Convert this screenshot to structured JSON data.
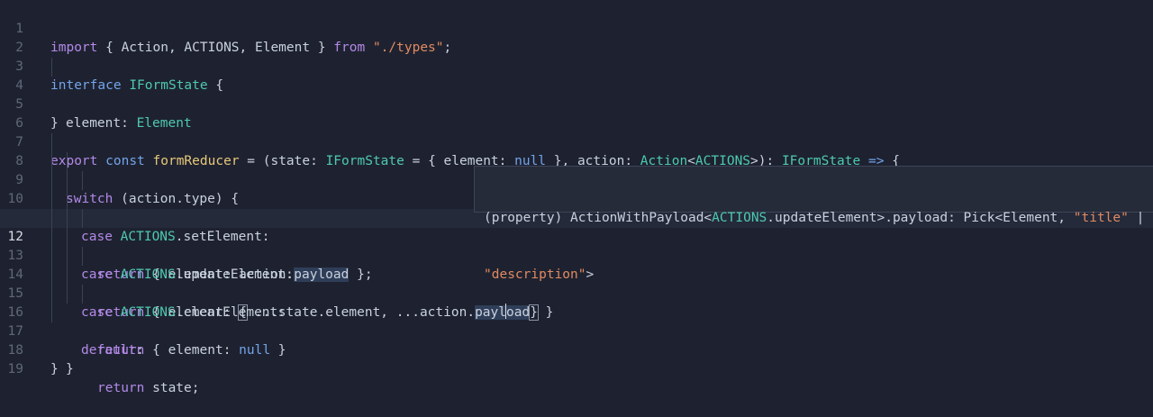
{
  "editor": {
    "line_numbers": [
      "1",
      "2",
      "3",
      "4",
      "5",
      "6",
      "7",
      "8",
      "9",
      "10",
      "11",
      "12",
      "13",
      "14",
      "15",
      "16",
      "17",
      "18",
      "19"
    ],
    "current_line": "12",
    "lines": {
      "l1": [
        "import",
        " { Action, ACTIONS, Element } ",
        "from",
        " ",
        "\"./types\"",
        ";"
      ],
      "l3": [
        "interface",
        " ",
        "IFormState",
        " {"
      ],
      "l4": [
        "element",
        ": ",
        "Element"
      ],
      "l5": [
        "}"
      ],
      "l7": [
        "export",
        " ",
        "const",
        " ",
        "formReducer",
        " = (state: ",
        "IFormState",
        " = { element: ",
        "null",
        " }, action: ",
        "Action",
        "<",
        "ACTIONS",
        ">): ",
        "IFormState",
        " ",
        "=>",
        " {"
      ],
      "l8": [
        "switch",
        " (action.type) {"
      ],
      "l9": [
        "case",
        " ",
        "ACTIONS",
        ".setElement:"
      ],
      "l10": [
        "return",
        " { element: action.",
        "payload",
        " };"
      ],
      "l11": [
        "case",
        " ",
        "ACTIONS",
        ".updateElement:"
      ],
      "l12": [
        "return",
        " { element: ",
        "{",
        " ...state.element, ...action.",
        "payl",
        "oad",
        "}",
        " }"
      ],
      "l13": [
        "case",
        " ",
        "ACTIONS",
        ".clearElement:"
      ],
      "l14": [
        "return",
        " { element: ",
        "null",
        " }"
      ],
      "l15": [
        "default",
        ":"
      ],
      "l16": [
        "return",
        " state;"
      ],
      "l17": [
        "}"
      ],
      "l18": [
        "}"
      ]
    }
  },
  "hover": {
    "line1": [
      "(property) ActionWithPayload<",
      "ACTIONS",
      ".updateElement>.payload: Pick<Element, ",
      "\"title\"",
      " |"
    ],
    "line2": [
      "\"description\"",
      ">"
    ]
  }
}
